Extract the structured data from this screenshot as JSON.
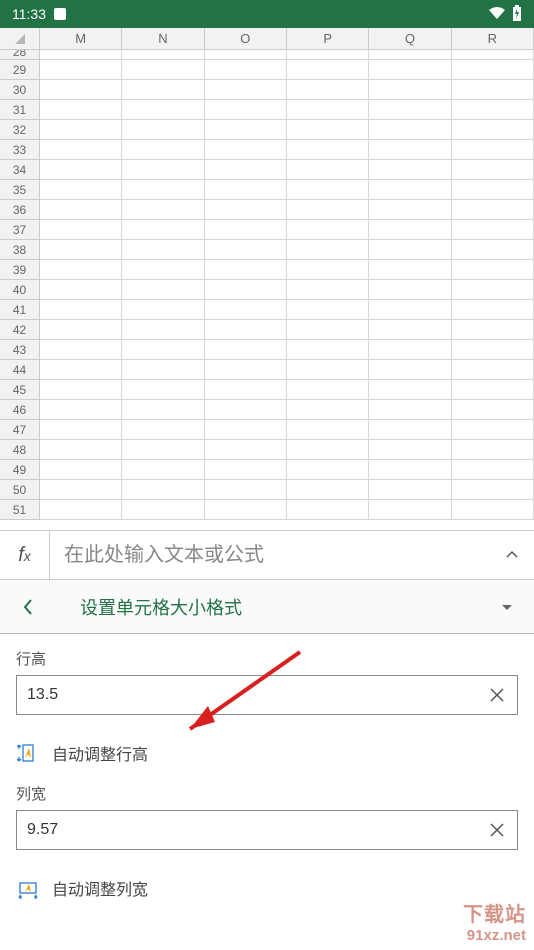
{
  "status_bar": {
    "time": "11:33"
  },
  "sheet": {
    "columns": [
      "M",
      "N",
      "O",
      "P",
      "Q",
      "R"
    ],
    "row_start_partial": "28",
    "rows": [
      "29",
      "30",
      "31",
      "32",
      "33",
      "34",
      "35",
      "36",
      "37",
      "38",
      "39",
      "40",
      "41",
      "42",
      "43",
      "44",
      "45",
      "46",
      "47",
      "48",
      "49",
      "50",
      "51"
    ]
  },
  "formula_bar": {
    "fx_label": "f",
    "fx_sub": "x",
    "placeholder": "在此处输入文本或公式"
  },
  "panel": {
    "title": "设置单元格大小格式",
    "row_height_label": "行高",
    "row_height_value": "13.5",
    "auto_row_height": "自动调整行高",
    "col_width_label": "列宽",
    "col_width_value": "9.57",
    "auto_col_width": "自动调整列宽"
  },
  "watermark": {
    "line1": "下载站",
    "line2": "91xz.net"
  }
}
